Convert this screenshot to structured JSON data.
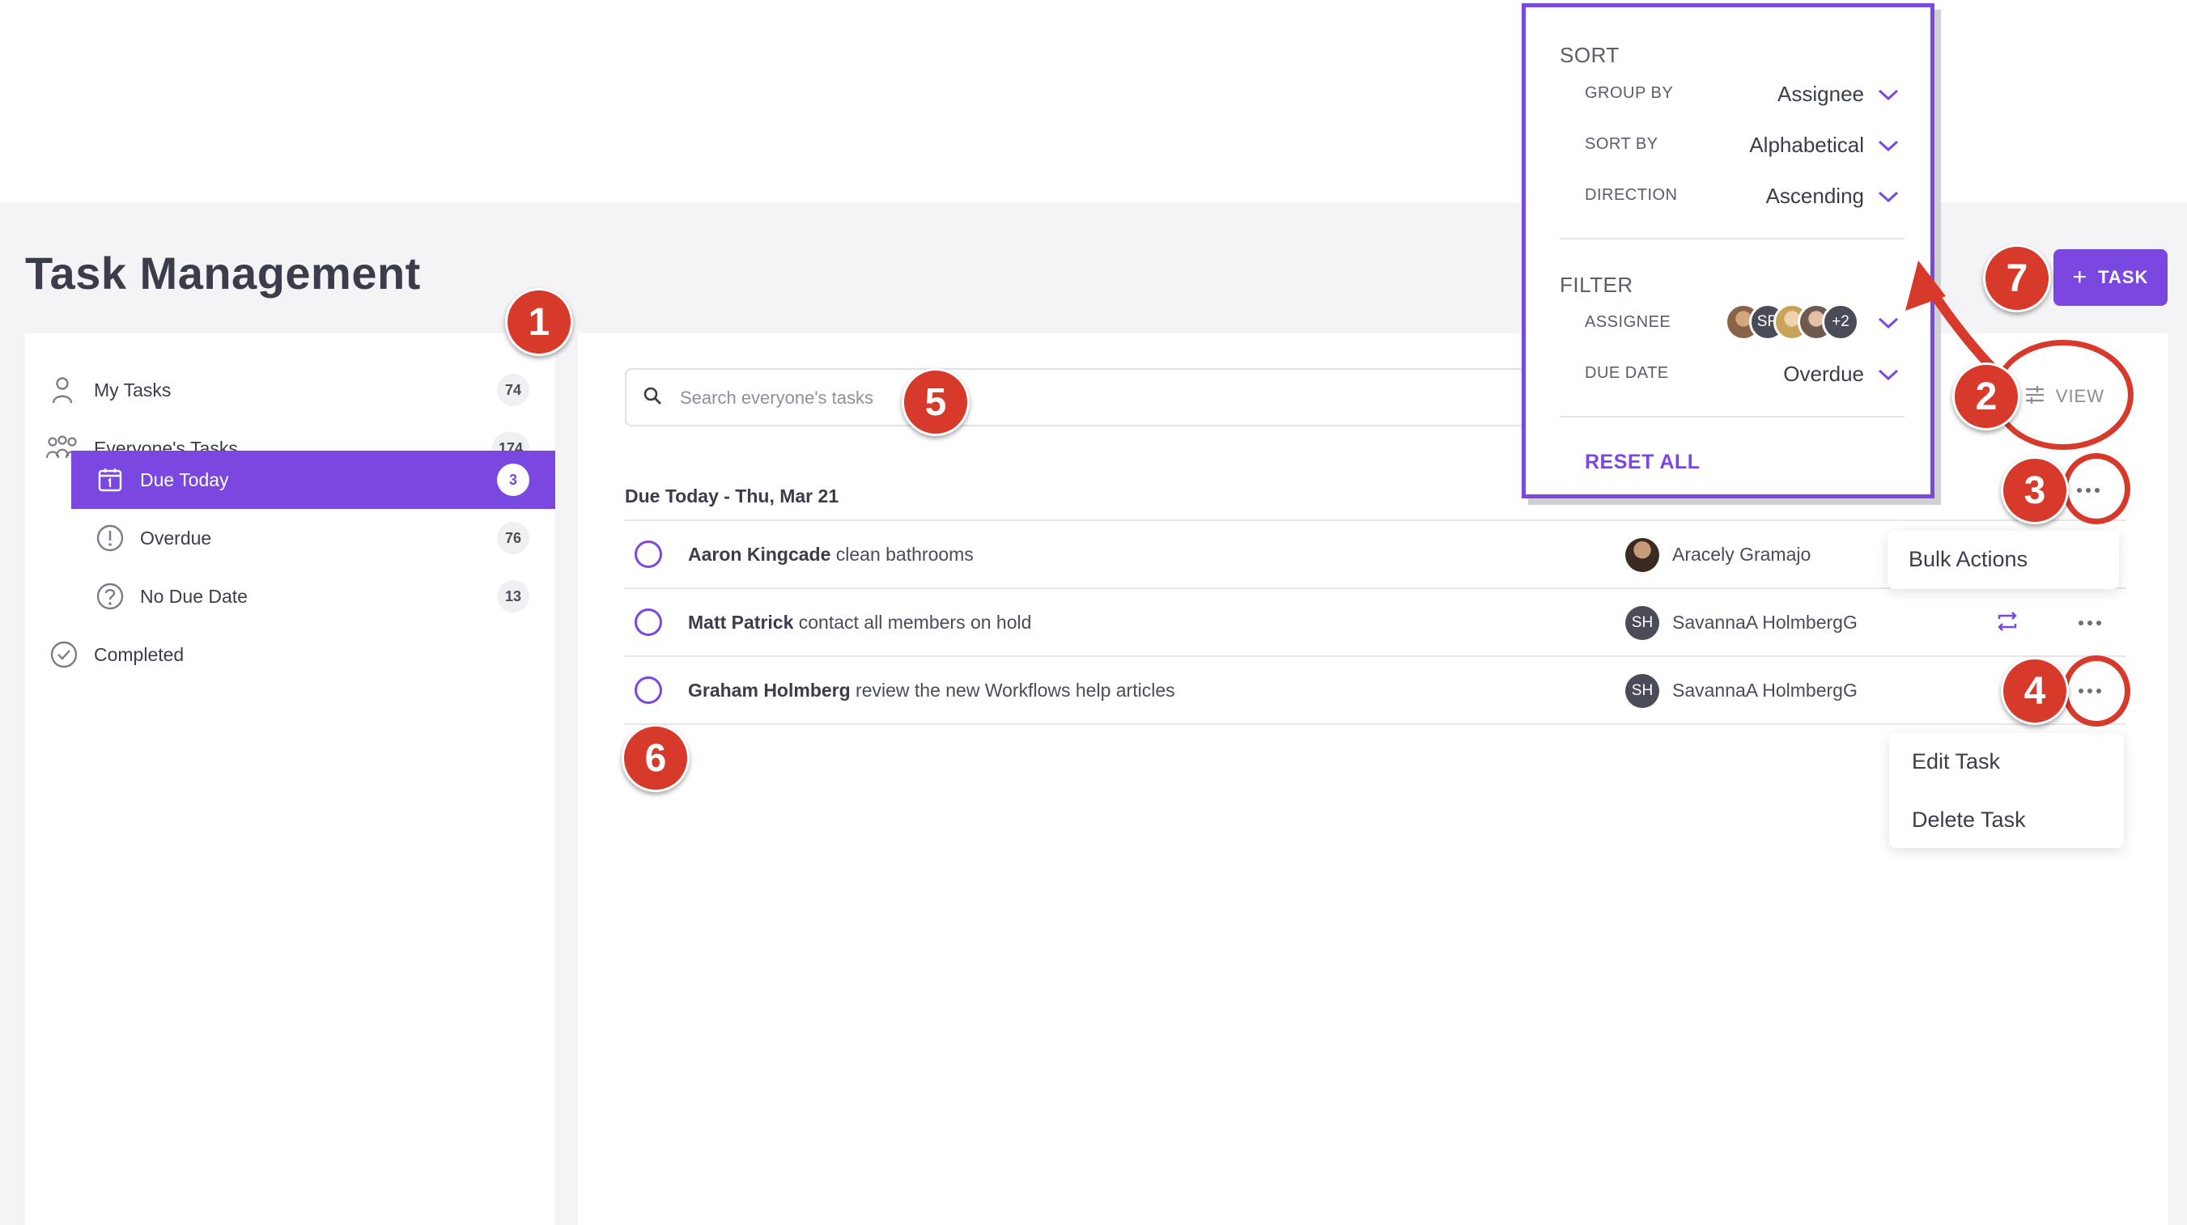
{
  "page_title": "Task Management",
  "sidebar": {
    "items": [
      {
        "label": "My Tasks",
        "count": "74",
        "icon": "person-icon"
      },
      {
        "label": "Everyone's Tasks",
        "count": "174",
        "icon": "people-icon"
      },
      {
        "label": "Due Today",
        "count": "3",
        "icon": "calendar-icon",
        "active": true
      },
      {
        "label": "Overdue",
        "count": "76",
        "icon": "exclamation-circle-icon"
      },
      {
        "label": "No Due Date",
        "count": "13",
        "icon": "question-circle-icon"
      },
      {
        "label": "Completed",
        "count": "",
        "icon": "check-circle-icon"
      }
    ]
  },
  "search": {
    "placeholder": "Search everyone's tasks"
  },
  "view_button": {
    "label": "VIEW"
  },
  "add_task_button": {
    "label": "TASK"
  },
  "section": {
    "title": "Due Today - Thu, Mar 21"
  },
  "tasks": [
    {
      "member": "Aaron Kingcade",
      "description": "clean bathrooms",
      "assignee": "Aracely Gramajo",
      "avatar": ""
    },
    {
      "member": "Matt Patrick",
      "description": "contact all members on hold",
      "assignee": "SavannaA HolmbergG",
      "avatar": "SH",
      "repeating": true
    },
    {
      "member": "Graham Holmberg",
      "description": "review the new Workflows help articles",
      "assignee": "SavannaA HolmbergG",
      "avatar": "SH"
    }
  ],
  "bulk_menu": {
    "items": [
      "Bulk Actions"
    ]
  },
  "task_menu": {
    "items": [
      "Edit Task",
      "Delete Task"
    ]
  },
  "popover": {
    "sort_title": "SORT",
    "group_by_label": "GROUP BY",
    "group_by_value": "Assignee",
    "sort_by_label": "SORT BY",
    "sort_by_value": "Alphabetical",
    "direction_label": "DIRECTION",
    "direction_value": "Ascending",
    "filter_title": "FILTER",
    "assignee_label": "ASSIGNEE",
    "assignee_avatars": [
      "",
      "SR",
      "",
      ""
    ],
    "assignee_more": "+2",
    "due_date_label": "DUE DATE",
    "due_date_value": "Overdue",
    "reset_label": "RESET ALL"
  },
  "annotations": [
    "1",
    "2",
    "3",
    "4",
    "5",
    "6",
    "7"
  ],
  "colors": {
    "accent": "#7a48e0",
    "annotation": "#d7392b",
    "background": "#f4f4f7"
  }
}
